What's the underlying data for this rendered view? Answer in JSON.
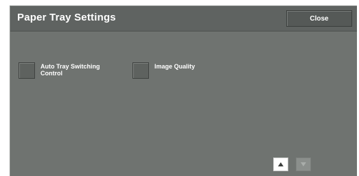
{
  "header": {
    "title": "Paper Tray Settings",
    "close_label": "Close"
  },
  "options": [
    {
      "label": "Auto Tray Switching Control"
    },
    {
      "label": "Image Quality"
    }
  ],
  "pager": {
    "up_icon": "triangle-up-icon",
    "down_icon": "triangle-down-icon",
    "down_enabled": false
  },
  "colors": {
    "panel_bg": "#6f7370",
    "header_bg": "#5f6361",
    "text": "#ffffff"
  }
}
